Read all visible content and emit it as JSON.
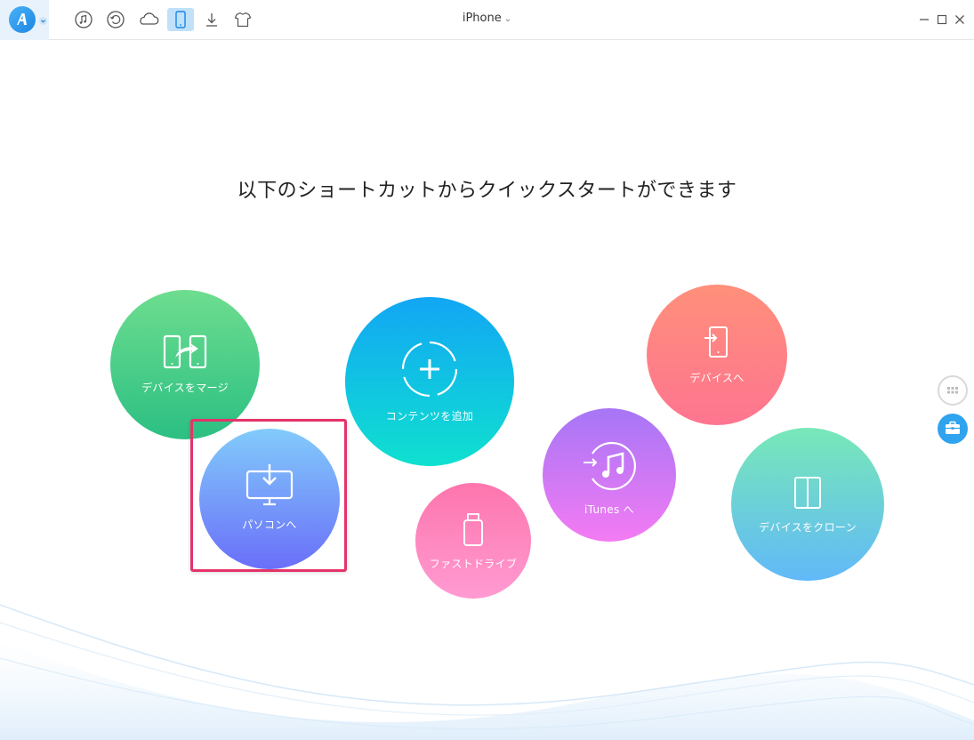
{
  "header": {
    "device_name": "iPhone",
    "device_chevron": "⌄",
    "toolbar": [
      {
        "name": "music-icon",
        "active": false
      },
      {
        "name": "restore-icon",
        "active": false
      },
      {
        "name": "cloud-icon",
        "active": false
      },
      {
        "name": "phone-icon",
        "active": true
      },
      {
        "name": "download-icon",
        "active": false
      },
      {
        "name": "tshirt-icon",
        "active": false
      }
    ],
    "window_controls": [
      "minimize-icon",
      "maximize-icon",
      "close-icon"
    ]
  },
  "main": {
    "headline": "以下のショートカットからクイックスタートができます",
    "shortcuts": {
      "merge": "デバイスをマージ",
      "add_content": "コンテンツを追加",
      "to_device": "デバイスへ",
      "itunes": "iTunes へ",
      "to_pc": "パソコンへ",
      "fast_drive": "ファストドライブ",
      "clone": "デバイスをクローン"
    }
  },
  "colors": {
    "accent": "#2fa3ee",
    "highlight": "#e4336a"
  }
}
